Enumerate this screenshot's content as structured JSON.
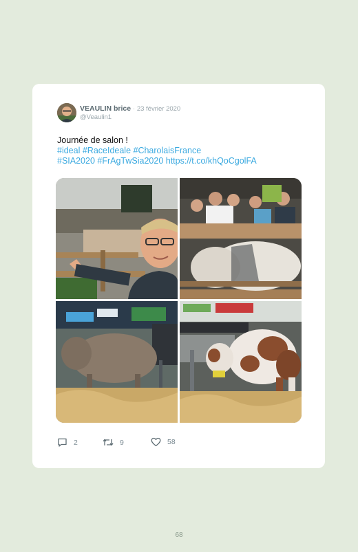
{
  "tweet": {
    "author_name": "VEAULIN brice",
    "date": "· 23 février 2020",
    "handle": "@Veaulin1",
    "text_line1": "Journée de salon !",
    "text_line2": "#ideal #RaceIdeale #CharolaisFrance",
    "text_line3": "#SIA2020 #FrAgTwSia2020 https://t.co/khQoCgolFA",
    "replies": "2",
    "retweets": "9",
    "likes": "58"
  },
  "photos": [
    {
      "subject": "selfie-at-cattle-pen"
    },
    {
      "subject": "white-cow-behind-fence-with-crowd"
    },
    {
      "subject": "brown-cow-on-straw"
    },
    {
      "subject": "red-and-white-spotted-cow-on-straw"
    }
  ],
  "icons": {
    "reply": "reply-icon",
    "retweet": "retweet-icon",
    "like": "heart-icon"
  },
  "colors": {
    "page_background": "#e3ebdd",
    "card": "#ffffff",
    "link": "#3aa9e0"
  },
  "page_number": "68"
}
